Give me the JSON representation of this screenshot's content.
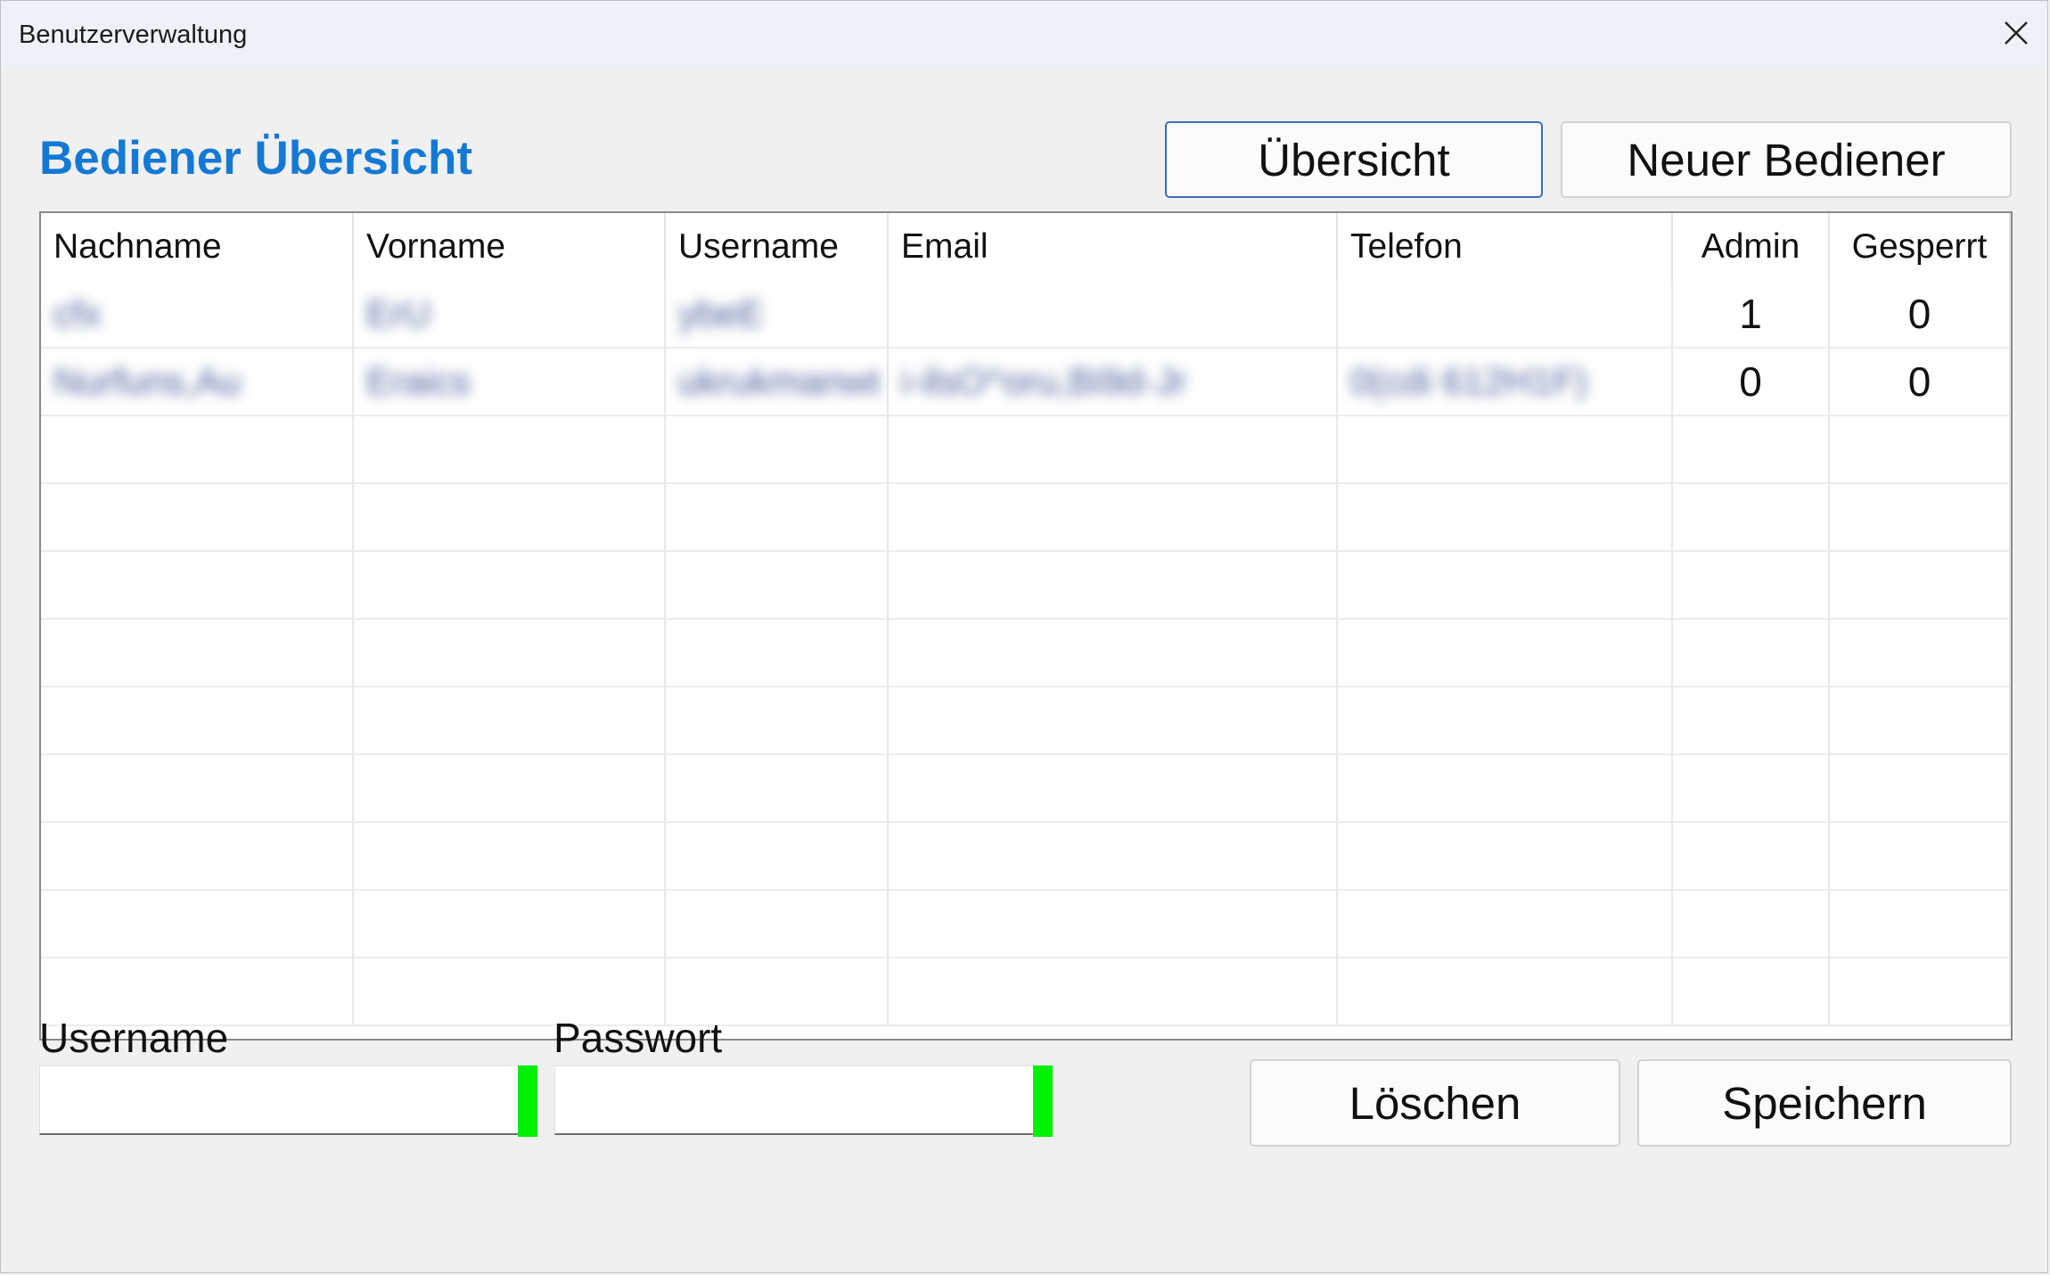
{
  "window": {
    "title": "Benutzerverwaltung",
    "close_icon": "close-icon"
  },
  "heading": "Bediener Übersicht",
  "buttons": {
    "overview": "Übersicht",
    "new_operator": "Neuer Bediener",
    "delete": "Löschen",
    "save": "Speichern"
  },
  "table": {
    "columns": [
      "Nachname",
      "Vorname",
      "Username",
      "Email",
      "Telefon",
      "Admin",
      "Gesperrt"
    ],
    "rows": [
      {
        "nachname": "cfx",
        "vorname": "ErU",
        "username": "ybeE",
        "email": "",
        "telefon": "",
        "admin": "1",
        "gesperrt": "0"
      },
      {
        "nachname": "Nurfuns,Au",
        "vorname": "Eraics",
        "username": "ukrukmanwt",
        "email": "i-ilsO^oru,Bi9d-Jr",
        "telefon": "0(cdi 612H1F)",
        "admin": "0",
        "gesperrt": "0"
      }
    ]
  },
  "form": {
    "username_label": "Username",
    "password_label": "Passwort",
    "username_value": "",
    "password_value": ""
  },
  "colors": {
    "accent": "#1479d4",
    "validity_indicator": "#00f000"
  }
}
